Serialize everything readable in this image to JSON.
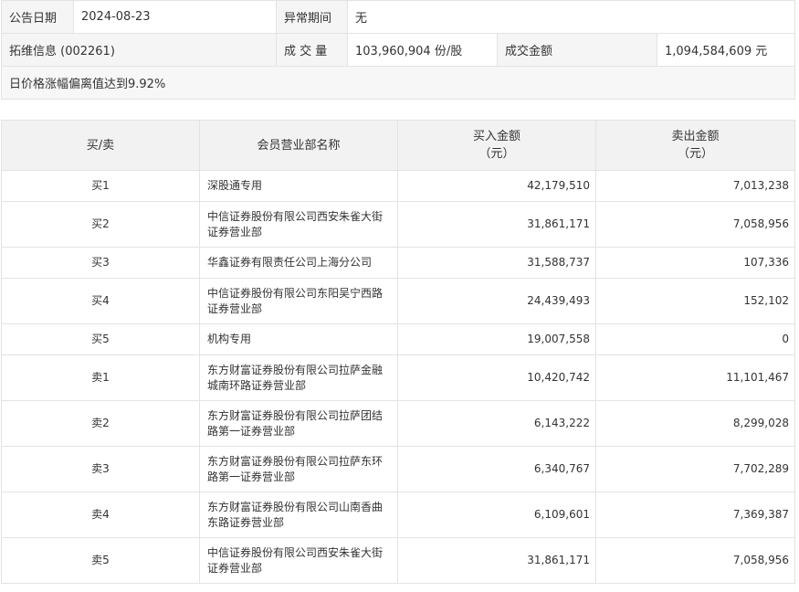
{
  "info": {
    "announce_date_label": "公告日期",
    "announce_date": "2024-08-23",
    "abnormal_period_label": "异常期间",
    "abnormal_period": "无",
    "stock": "拓维信息 (002261)",
    "volume_label": "成 交 量",
    "volume": "103,960,904 份/股",
    "amount_label": "成交金额",
    "amount": "1,094,584,609 元",
    "reason": "日价格涨幅偏离值达到9.92%"
  },
  "table": {
    "headers": {
      "side": "买/卖",
      "name": "会员营业部名称",
      "buy": "买入金额\n（元）",
      "sell": "卖出金额\n（元）"
    },
    "rows": [
      {
        "side": "买1",
        "name": "深股通专用",
        "buy": "42,179,510",
        "sell": "7,013,238"
      },
      {
        "side": "买2",
        "name": "中信证券股份有限公司西安朱雀大街证券营业部",
        "buy": "31,861,171",
        "sell": "7,058,956"
      },
      {
        "side": "买3",
        "name": "华鑫证券有限责任公司上海分公司",
        "buy": "31,588,737",
        "sell": "107,336"
      },
      {
        "side": "买4",
        "name": "中信证券股份有限公司东阳吴宁西路证券营业部",
        "buy": "24,439,493",
        "sell": "152,102"
      },
      {
        "side": "买5",
        "name": "机构专用",
        "buy": "19,007,558",
        "sell": "0"
      },
      {
        "side": "卖1",
        "name": "东方财富证券股份有限公司拉萨金融城南环路证券营业部",
        "buy": "10,420,742",
        "sell": "11,101,467"
      },
      {
        "side": "卖2",
        "name": "东方财富证券股份有限公司拉萨团结路第一证券营业部",
        "buy": "6,143,222",
        "sell": "8,299,028"
      },
      {
        "side": "卖3",
        "name": "东方财富证券股份有限公司拉萨东环路第一证券营业部",
        "buy": "6,340,767",
        "sell": "7,702,289"
      },
      {
        "side": "卖4",
        "name": "东方财富证券股份有限公司山南香曲东路证券营业部",
        "buy": "6,109,601",
        "sell": "7,369,387"
      },
      {
        "side": "卖5",
        "name": "中信证券股份有限公司西安朱雀大街证券营业部",
        "buy": "31,861,171",
        "sell": "7,058,956"
      }
    ]
  }
}
